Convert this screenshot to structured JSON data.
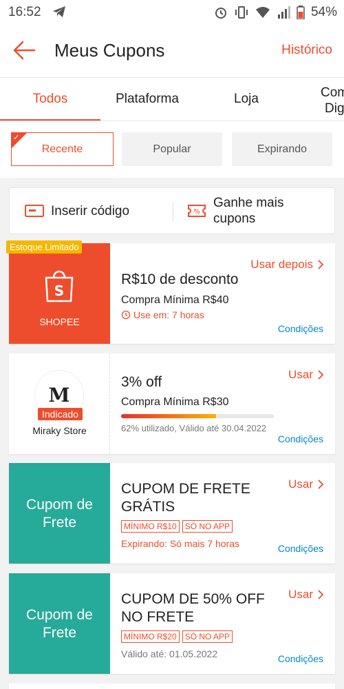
{
  "status_bar": {
    "time": "16:52",
    "battery": "54%"
  },
  "header": {
    "title": "Meus Cupons",
    "history_label": "Histórico"
  },
  "tabs": [
    {
      "label": "Todos",
      "active": true
    },
    {
      "label": "Plataforma",
      "active": false
    },
    {
      "label": "Loja",
      "active": false
    }
  ],
  "tab_cut": {
    "line1": "Com",
    "line2": "Dig"
  },
  "filters": [
    {
      "label": "Recente",
      "active": true
    },
    {
      "label": "Popular",
      "active": false
    },
    {
      "label": "Expirando",
      "active": false
    }
  ],
  "code_row": {
    "insert_label": "Inserir código",
    "earn_line1": "Ganhe mais",
    "earn_line2": "cupons"
  },
  "coupons": [
    {
      "stub_label": "SHOPEE",
      "badge": "Estoque Limitado",
      "title": "R$10 de desconto",
      "min": "Compra Mínima R$40",
      "validity": "Use em: 7 horas",
      "action": "Usar depois",
      "conditions": "Condições"
    },
    {
      "store": "Miraky Store",
      "avatar_letter": "M",
      "tag": "Indicado",
      "title": "3% off",
      "min": "Compra Mínima R$30",
      "usage_pct": 62,
      "usage_text": "62% utilizado, Válido até 30.04.2022",
      "action": "Usar",
      "conditions": "Condições"
    },
    {
      "stub_line1": "Cupom de",
      "stub_line2": "Frete",
      "title_line1": "CUPOM DE FRETE",
      "title_line2": "GRÁTIS",
      "chips": [
        "MÍNIMO R$10",
        "SÓ NO APP"
      ],
      "note": "Expirando: Só mais 7 horas",
      "action": "Usar",
      "conditions": "Condições"
    },
    {
      "stub_line1": "Cupom de",
      "stub_line2": "Frete",
      "title_line1": "CUPOM DE 50% OFF",
      "title_line2": "NO FRETE",
      "chips": [
        "MÍNIMO R$20",
        "SÓ NO APP"
      ],
      "note": "Válido até: 01.05.2022",
      "action": "Usar",
      "conditions": "Condições"
    }
  ],
  "colors": {
    "accent": "#ee4d2d",
    "teal": "#26aa99",
    "link": "#0088cc",
    "badge": "#f5b800"
  },
  "icons": [
    "telegram-icon",
    "alarm-icon",
    "vibrate-icon",
    "wifi-icon",
    "signal-icon",
    "battery-icon",
    "back-arrow-icon",
    "ticket-icon",
    "percent-ticket-icon",
    "shopee-bag-icon",
    "clock-icon",
    "chevron-right-icon"
  ]
}
